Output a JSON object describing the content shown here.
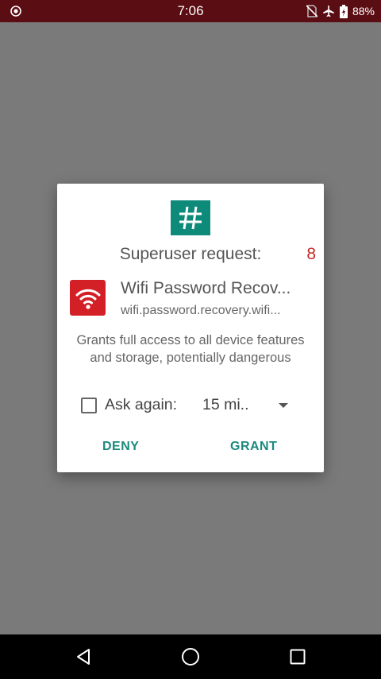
{
  "status_bar": {
    "time": "7:06",
    "battery": "88%",
    "icons": [
      "record-icon",
      "no-sim-icon",
      "airplane-icon",
      "battery-icon"
    ]
  },
  "dialog": {
    "title": "Superuser request:",
    "countdown": "8",
    "app_name": "Wifi Password Recov...",
    "app_package": "wifi.password.recovery.wifi...",
    "warning": "Grants full access to all device features and storage, potentially dangerous",
    "ask_again_label": "Ask again:",
    "ask_again_checked": false,
    "duration": "15 mi..",
    "deny_label": "DENY",
    "grant_label": "GRANT"
  },
  "colors": {
    "status_bar": "#5a0d12",
    "accent": "#1a8a7e",
    "countdown": "#c62828",
    "app_icon_bg": "#d32027",
    "superuser_logo_bg": "#0e8a7a"
  },
  "nav_bar": {
    "buttons": [
      "back-icon",
      "home-icon",
      "recents-icon"
    ]
  }
}
